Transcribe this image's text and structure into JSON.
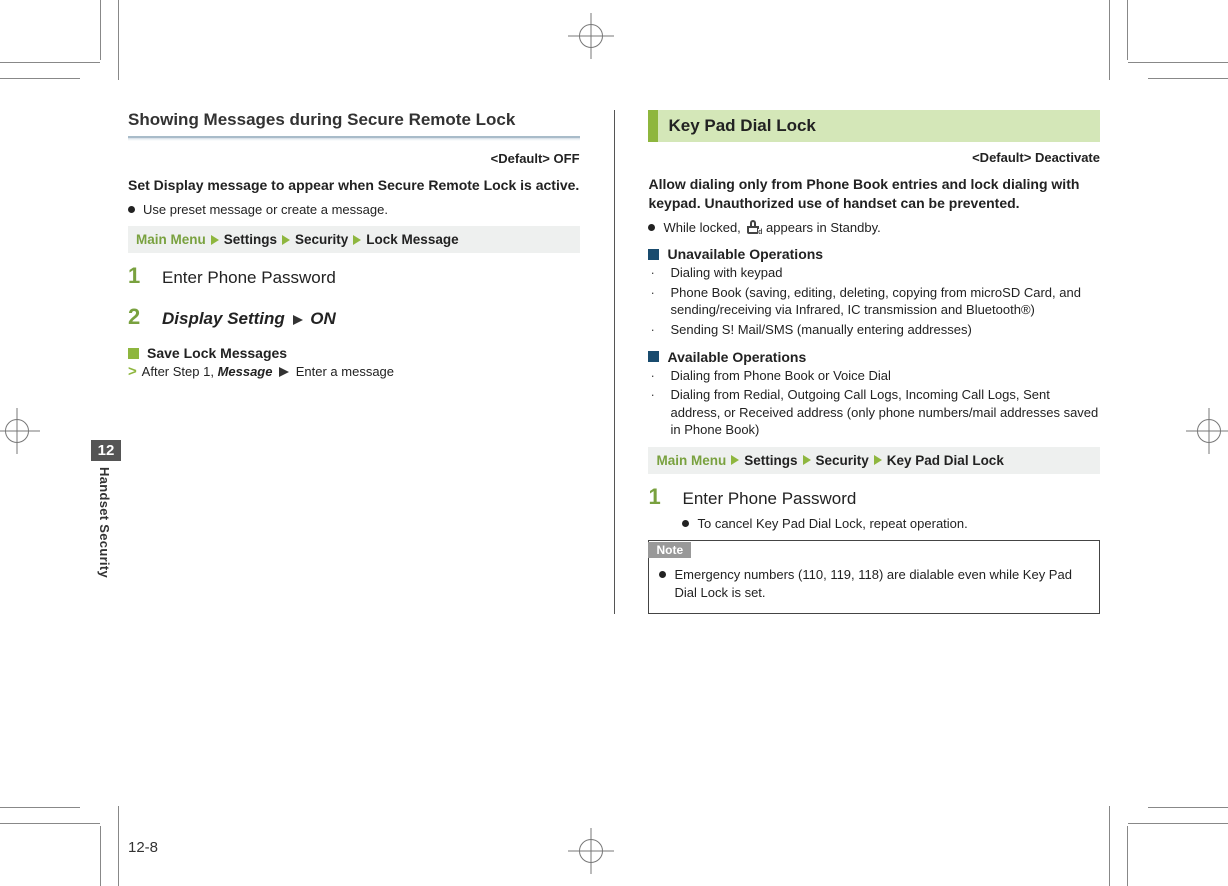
{
  "page": {
    "chapter_num": "12",
    "chapter_label": "Handset Security",
    "page_number": "12-8"
  },
  "breadcrumb_labels": {
    "main": "Main Menu",
    "settings": "Settings",
    "security": "Security"
  },
  "left": {
    "title": "Showing Messages during Secure Remote Lock",
    "default": "<Default> OFF",
    "intro": "Set Display message to appear when Secure Remote Lock is active.",
    "bullet1": "Use preset message or create a message.",
    "bc_last": "Lock Message",
    "step1_num": "1",
    "step1_txt": "Enter Phone Password",
    "step2_num": "2",
    "step2_a": "Display Setting",
    "step2_b": "ON",
    "sub_title": "Save Lock Messages",
    "sub_body_a": "After Step 1,",
    "sub_body_b": "Message",
    "sub_body_c": "Enter a message"
  },
  "right": {
    "band": "Key Pad Dial Lock",
    "default": "<Default> Deactivate",
    "intro": "Allow dialing only from Phone Book entries and lock dialing with keypad. Unauthorized use of handset can be prevented.",
    "bullet1_a": "While locked,",
    "bullet1_b": "appears in Standby.",
    "unavail_h": "Unavailable Operations",
    "unavail_1": "Dialing with keypad",
    "unavail_2": "Phone Book (saving, editing, deleting, copying from microSD Card, and sending/receiving via Infrared, IC transmission and Bluetooth®)",
    "unavail_3": "Sending S! Mail/SMS (manually entering addresses)",
    "avail_h": "Available Operations",
    "avail_1": "Dialing from Phone Book or Voice Dial",
    "avail_2": "Dialing from Redial, Outgoing Call Logs, Incoming Call Logs, Sent address, or Received address (only phone numbers/mail addresses saved in Phone Book)",
    "bc_last": "Key Pad Dial Lock",
    "step1_num": "1",
    "step1_txt": "Enter Phone Password",
    "step1_sub": "To cancel Key Pad Dial Lock, repeat operation.",
    "note_label": "Note",
    "note_body": "Emergency numbers (110, 119, 118) are dialable even while Key Pad Dial Lock is set."
  }
}
